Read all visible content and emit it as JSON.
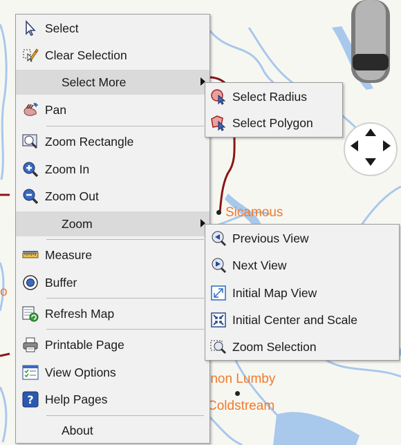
{
  "map": {
    "places": {
      "sicamous": "Sicamous",
      "lumby": "rnon Lumby",
      "coldstream": "Coldstream",
      "edge_fragment": "o"
    },
    "colors": {
      "water": "#a8c8ec",
      "road": "#8b1515",
      "label": "#f07a2a"
    }
  },
  "context_menu": {
    "items": [
      {
        "label": "Select",
        "icon": "cursor-icon"
      },
      {
        "label": "Clear Selection",
        "icon": "clear-selection-icon"
      },
      {
        "label": "Select More",
        "icon": ""
      },
      {
        "label": "Pan",
        "icon": "pan-hand-icon"
      },
      {
        "label": "Zoom Rectangle",
        "icon": "zoom-rectangle-icon"
      },
      {
        "label": "Zoom In",
        "icon": "zoom-in-icon"
      },
      {
        "label": "Zoom Out",
        "icon": "zoom-out-icon"
      },
      {
        "label": "Zoom",
        "icon": ""
      },
      {
        "label": "Measure",
        "icon": "ruler-icon"
      },
      {
        "label": "Buffer",
        "icon": "buffer-icon"
      },
      {
        "label": "Refresh Map",
        "icon": "refresh-map-icon"
      },
      {
        "label": "Printable Page",
        "icon": "printer-icon"
      },
      {
        "label": "View Options",
        "icon": "view-options-icon"
      },
      {
        "label": "Help Pages",
        "icon": "help-icon"
      },
      {
        "label": "About",
        "icon": ""
      }
    ]
  },
  "select_more_submenu": {
    "items": [
      {
        "label": "Select Radius",
        "icon": "select-radius-icon"
      },
      {
        "label": "Select Polygon",
        "icon": "select-polygon-icon"
      }
    ]
  },
  "zoom_submenu": {
    "items": [
      {
        "label": "Previous View",
        "icon": "previous-view-icon"
      },
      {
        "label": "Next View",
        "icon": "next-view-icon"
      },
      {
        "label": "Initial Map View",
        "icon": "initial-map-view-icon"
      },
      {
        "label": "Initial Center and Scale",
        "icon": "initial-center-scale-icon"
      },
      {
        "label": "Zoom Selection",
        "icon": "zoom-selection-icon"
      }
    ]
  }
}
